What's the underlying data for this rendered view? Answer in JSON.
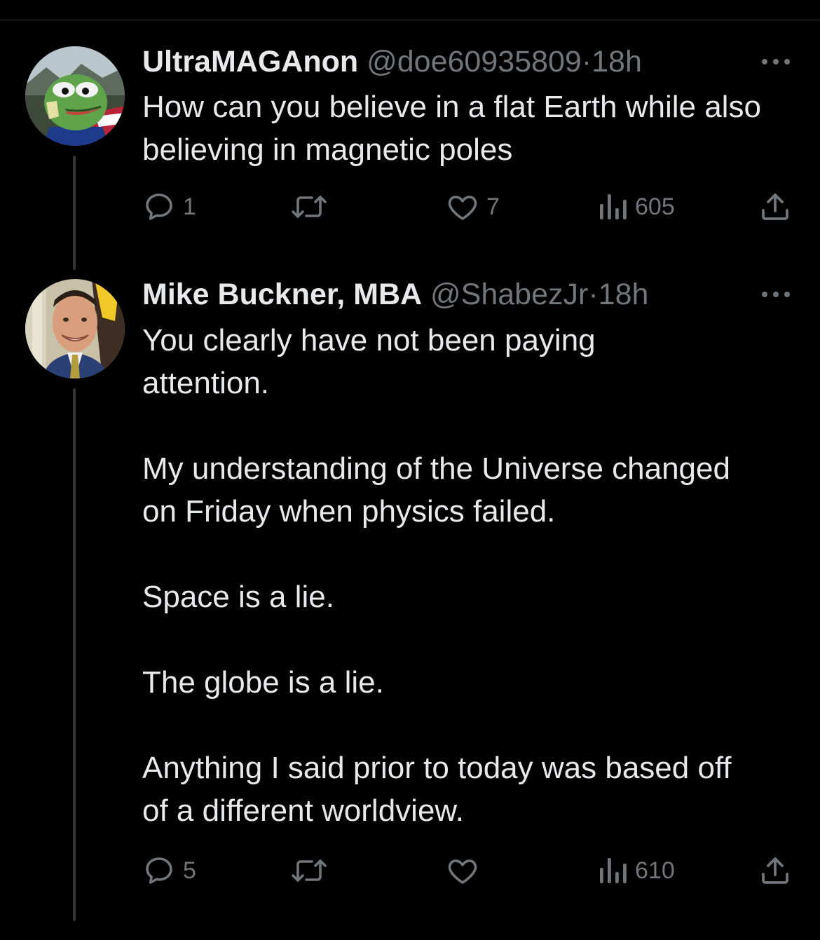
{
  "colors": {
    "background": "#000000",
    "text_primary": "#e7e9ea",
    "text_secondary": "#71767b",
    "thread_line": "#333639"
  },
  "tweets": [
    {
      "display_name": "UltraMAGAnon",
      "handle": "@doe60935809",
      "separator": "·",
      "time": "18h",
      "avatar": "pepe-frog-avatar",
      "paragraphs": [
        "How can you believe in a flat Earth while also believing in magnetic poles"
      ],
      "replies": "1",
      "reposts": "",
      "likes": "7",
      "views": "605"
    },
    {
      "display_name": "Mike Buckner, MBA",
      "handle": "@ShabezJr",
      "separator": "·",
      "time": "18h",
      "avatar": "smiling-man-avatar",
      "paragraphs": [
        "You clearly have not been paying attention.",
        "My understanding of the Universe changed on Friday when physics failed.",
        "Space is a lie.",
        "The globe is a lie.",
        "Anything I said prior to today was based off of a different worldview."
      ],
      "replies": "5",
      "reposts": "",
      "likes": "",
      "views": "610"
    }
  ],
  "icons": {
    "reply": "reply-icon",
    "repost": "repost-icon",
    "like": "heart-icon",
    "views": "views-icon",
    "share": "share-icon",
    "more": "more-icon"
  }
}
